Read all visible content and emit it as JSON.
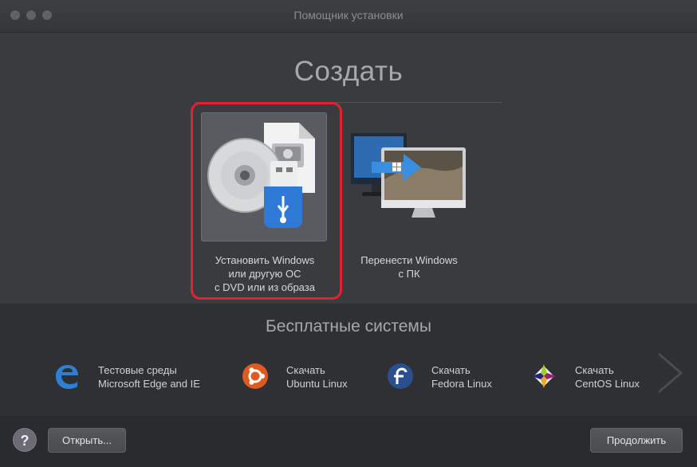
{
  "window": {
    "title": "Помощник установки"
  },
  "create": {
    "title": "Создать",
    "options": [
      {
        "label": "Установить Windows\nили другую ОС\nс DVD или из образа",
        "icon": "dvd-usb-image-icon",
        "selected": true
      },
      {
        "label": "Перенести Windows\nс ПК",
        "icon": "pc-to-mac-transfer-icon",
        "selected": false
      }
    ]
  },
  "free_systems": {
    "title": "Бесплатные системы",
    "items": [
      {
        "label": "Тестовые среды\nMicrosoft Edge and IE",
        "icon": "edge-icon"
      },
      {
        "label": "Скачать\nUbuntu Linux",
        "icon": "ubuntu-icon"
      },
      {
        "label": "Скачать\nFedora Linux",
        "icon": "fedora-icon"
      },
      {
        "label": "Скачать\nCentOS Linux",
        "icon": "centos-icon"
      }
    ]
  },
  "footer": {
    "help_label": "?",
    "open_label": "Открыть...",
    "continue_label": "Продолжить"
  },
  "colors": {
    "highlight": "#e2232e",
    "background": "#3b3c40",
    "accent_blue": "#2e7ad6"
  }
}
